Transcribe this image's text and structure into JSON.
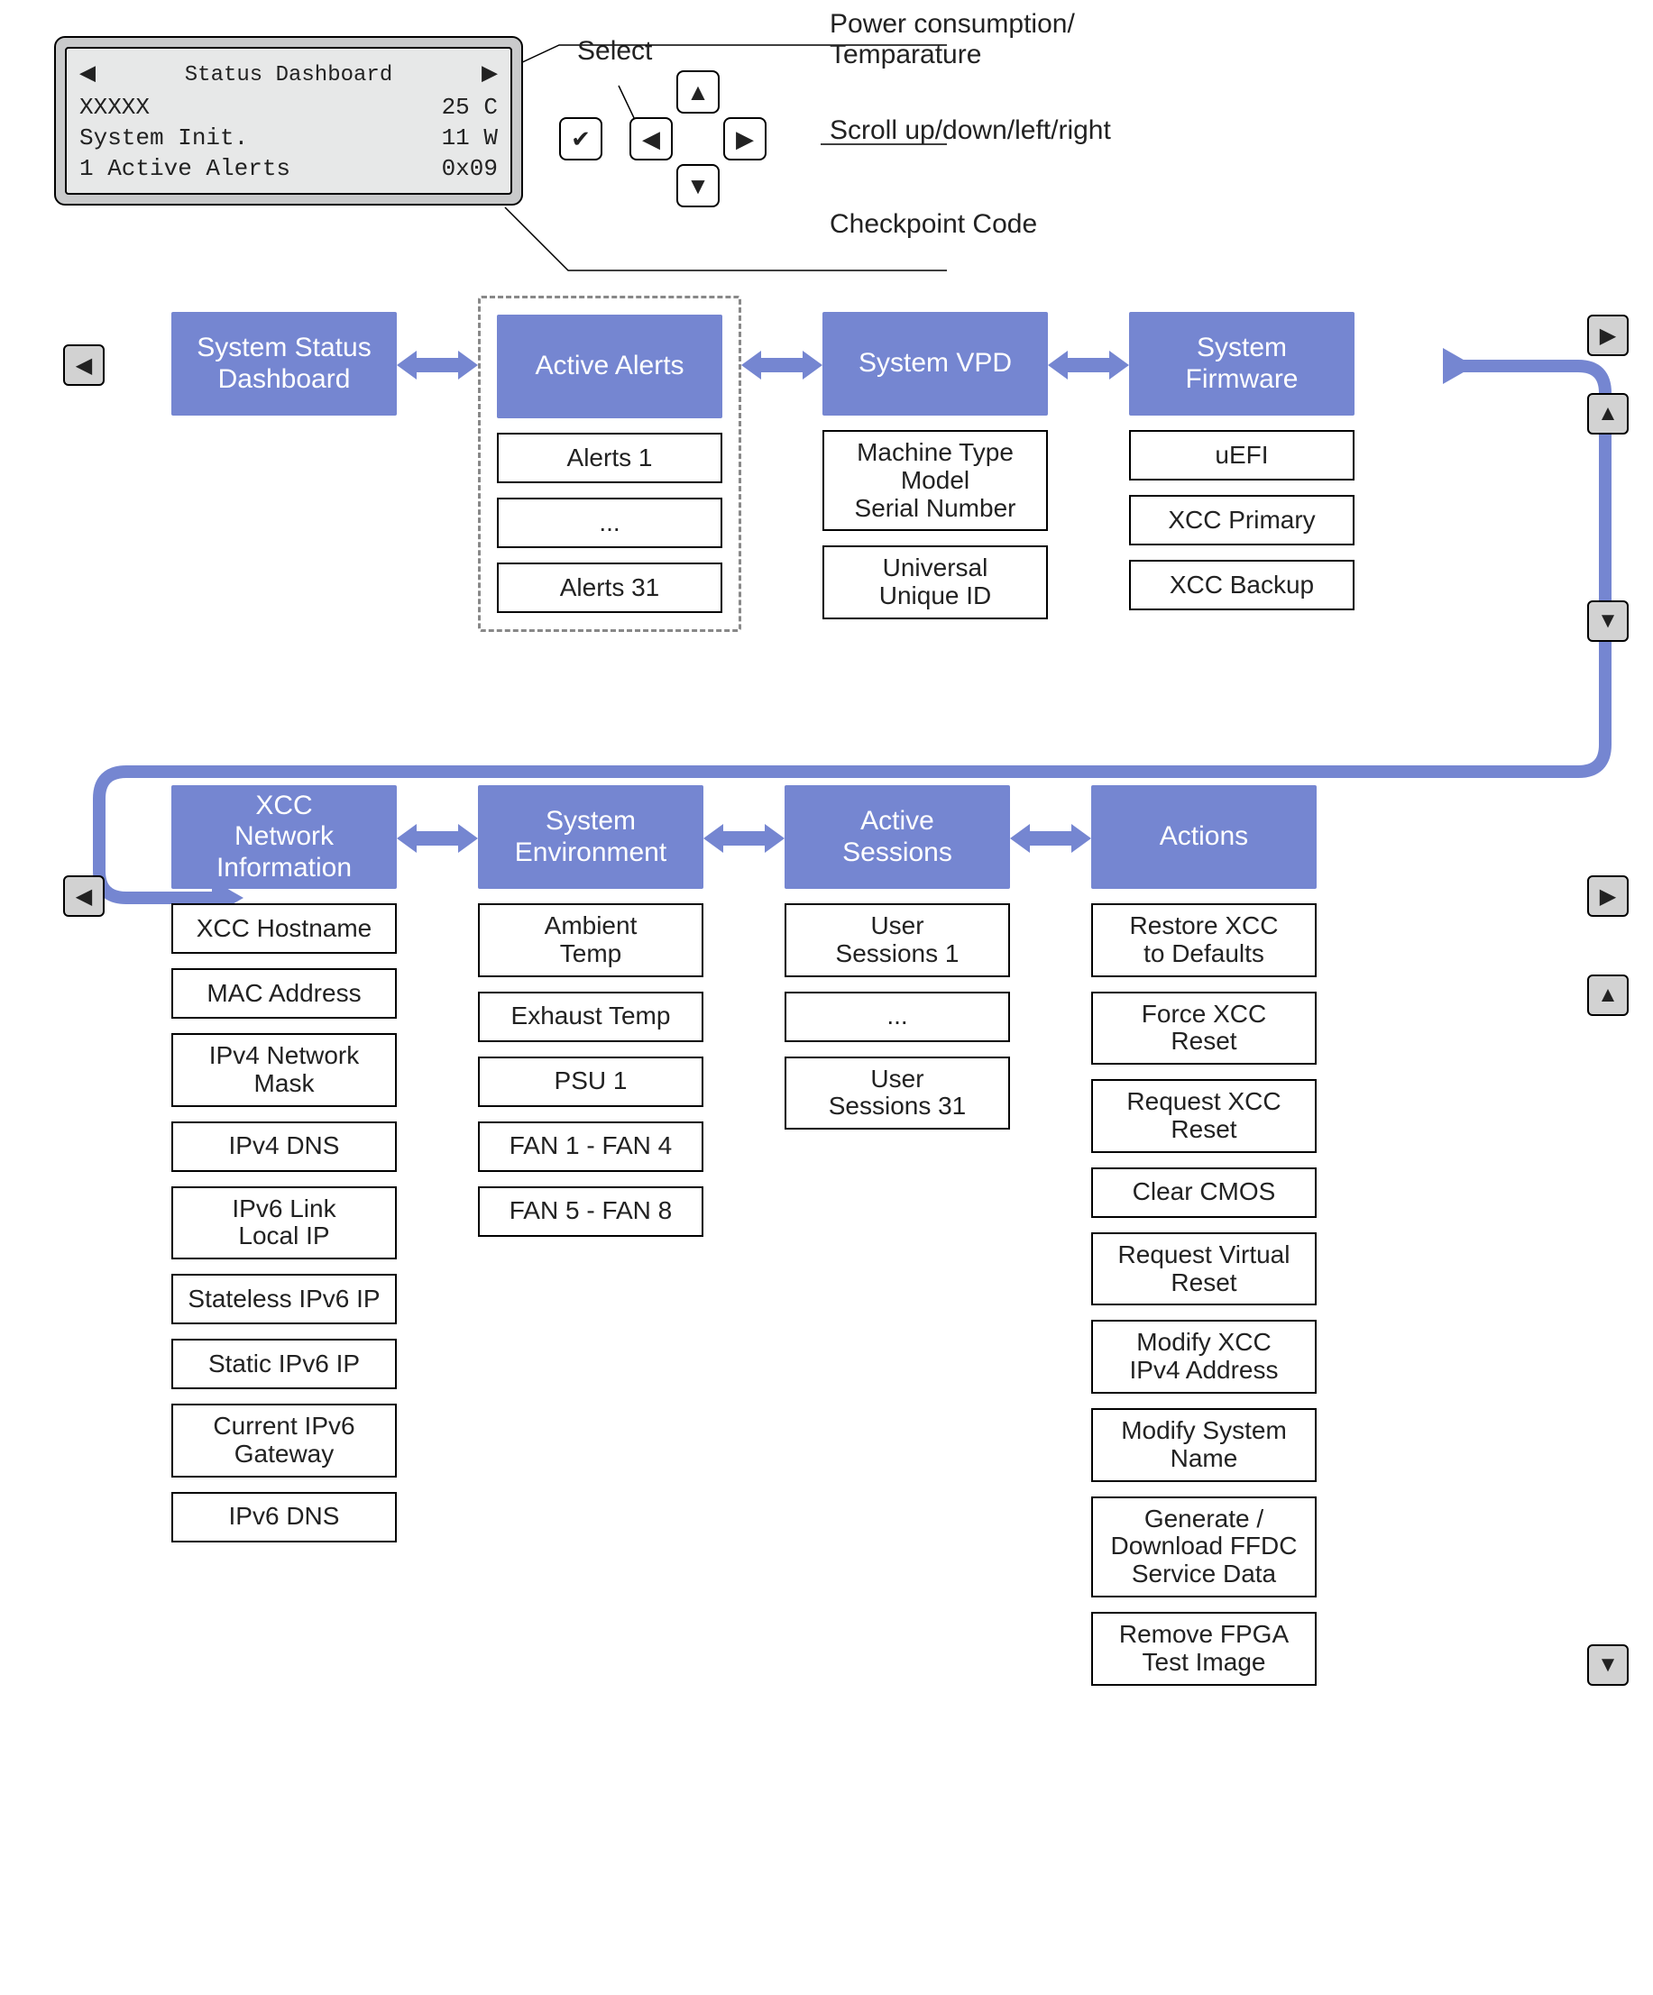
{
  "lcd": {
    "title": "Status Dashboard",
    "line1_left": "XXXXX",
    "line1_right": "25 C",
    "line2_left": "System Init.",
    "line2_right": "11 W",
    "line3_left": "1 Active Alerts",
    "line3_right": "0x09"
  },
  "callouts": {
    "select": "Select",
    "power_temp": "Power consumption/\nTemparature",
    "scroll": "Scroll up/down/left/right",
    "checkpoint": "Checkpoint Code"
  },
  "row1": {
    "status": "System Status\nDashboard",
    "alerts": "Active Alerts",
    "alerts_items": [
      "Alerts 1",
      "...",
      "Alerts 31"
    ],
    "vpd": "System VPD",
    "vpd_items": [
      "Machine Type\nModel\nSerial Number",
      "Universal\nUnique ID"
    ],
    "firmware": "System\nFirmware",
    "firmware_items": [
      "uEFI",
      "XCC Primary",
      "XCC Backup"
    ]
  },
  "row2": {
    "net": "XCC\nNetwork\nInformation",
    "net_items": [
      "XCC Hostname",
      "MAC Address",
      "IPv4 Network\nMask",
      "IPv4 DNS",
      "IPv6 Link\nLocal IP",
      "Stateless IPv6 IP",
      "Static IPv6 IP",
      "Current IPv6\nGateway",
      "IPv6 DNS"
    ],
    "env": "System\nEnvironment",
    "env_items": [
      "Ambient\nTemp",
      "Exhaust Temp",
      "PSU 1",
      "FAN 1 - FAN 4",
      "FAN 5 - FAN 8"
    ],
    "sess": "Active\nSessions",
    "sess_items": [
      "User\nSessions 1",
      "...",
      "User\nSessions 31"
    ],
    "actions": "Actions",
    "actions_items": [
      "Restore XCC\nto Defaults",
      "Force XCC\nReset",
      "Request XCC\nReset",
      "Clear CMOS",
      "Request Virtual\nReset",
      "Modify XCC\nIPv4 Address",
      "Modify System\nName",
      "Generate /\nDownload FFDC\nService Data",
      "Remove FPGA\nTest Image"
    ]
  }
}
